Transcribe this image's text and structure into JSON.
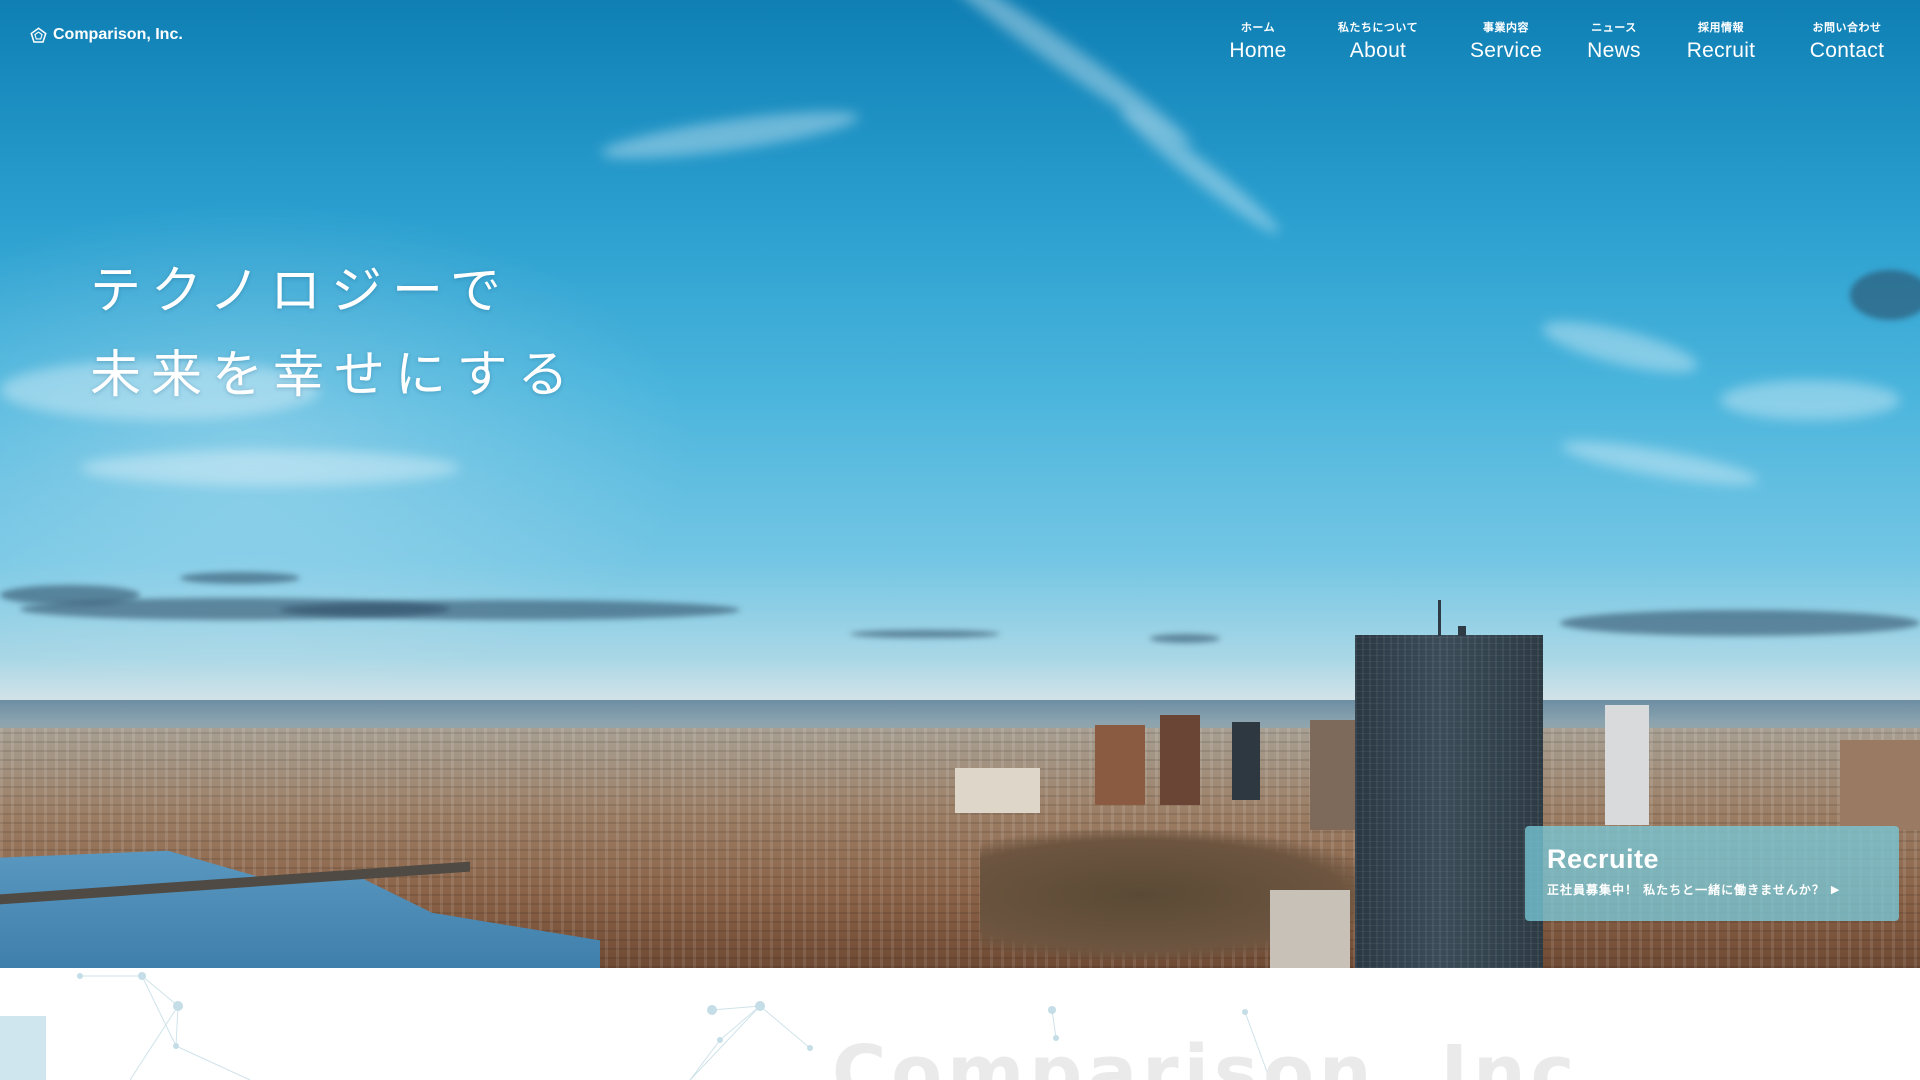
{
  "header": {
    "logo_text": "Comparison, Inc.",
    "logo_icon": "pentagon-logo-icon"
  },
  "nav": {
    "items": [
      {
        "sub": "ホーム",
        "label": "Home"
      },
      {
        "sub": "私たちについて",
        "label": "About"
      },
      {
        "sub": "事業内容",
        "label": "Service"
      },
      {
        "sub": "ニュース",
        "label": "News"
      },
      {
        "sub": "採用情報",
        "label": "Recruit"
      },
      {
        "sub": "お問い合わせ",
        "label": "Contact"
      }
    ]
  },
  "hero": {
    "line1": "テクノロジーで",
    "line2": "未来を幸せにする"
  },
  "recruit_card": {
    "title": "Recruite",
    "subtitle": "正社員募集中！ 私たちと一緒に働きませんか？",
    "arrow_icon": "caret-right-icon"
  },
  "section": {
    "heading": "Comparison, Inc"
  },
  "colors": {
    "accent": "#78c8d7",
    "sky_top": "#0f7fb4",
    "text_light": "#ffffff",
    "heading_faint": "#eaeaea"
  }
}
